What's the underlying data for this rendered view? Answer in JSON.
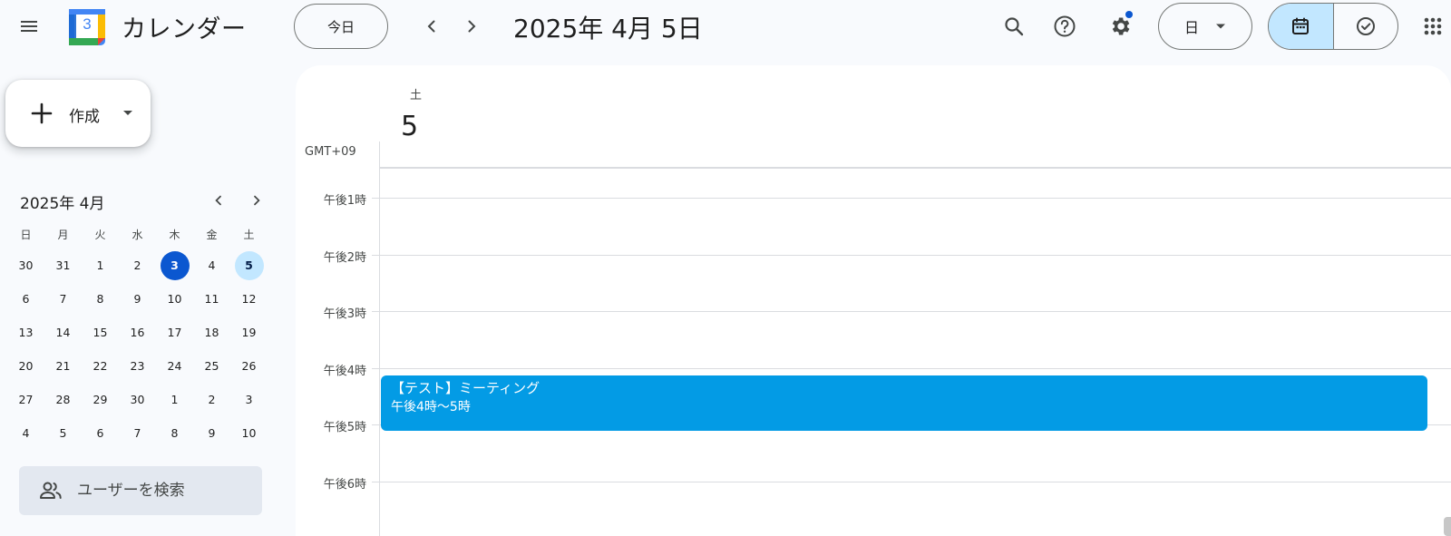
{
  "header": {
    "app_title": "カレンダー",
    "logo_number": "3",
    "today_label": "今日",
    "date_title": "2025年 4月 5日",
    "view_label": "日",
    "icons": [
      "menu-icon",
      "calendar-logo-icon",
      "chevron-left-icon",
      "chevron-right-icon",
      "search-icon",
      "help-icon",
      "settings-icon",
      "caret-down-icon",
      "calendar-icon",
      "task-check-icon",
      "apps-grid-icon"
    ]
  },
  "sidebar": {
    "create_label": "作成",
    "mini_calendar": {
      "month_label": "2025年 4月",
      "weekdays": [
        "日",
        "月",
        "火",
        "水",
        "木",
        "金",
        "土"
      ],
      "weeks": [
        [
          "30",
          "31",
          "1",
          "2",
          "3",
          "4",
          "5"
        ],
        [
          "6",
          "7",
          "8",
          "9",
          "10",
          "11",
          "12"
        ],
        [
          "13",
          "14",
          "15",
          "16",
          "17",
          "18",
          "19"
        ],
        [
          "20",
          "21",
          "22",
          "23",
          "24",
          "25",
          "26"
        ],
        [
          "27",
          "28",
          "29",
          "30",
          "1",
          "2",
          "3"
        ],
        [
          "4",
          "5",
          "6",
          "7",
          "8",
          "9",
          "10"
        ]
      ],
      "today": "3",
      "selected": "5"
    },
    "user_search_placeholder": "ユーザーを検索"
  },
  "main": {
    "day_of_week": "土",
    "day_number": "5",
    "timezone": "GMT+09",
    "hours": [
      "午後1時",
      "午後2時",
      "午後3時",
      "午後4時",
      "午後5時",
      "午後6時"
    ],
    "event": {
      "title": "【テスト】ミーティング",
      "time": "午後4時～5時",
      "color": "#039be5"
    }
  },
  "colors": {
    "accent": "#0b57d0",
    "selected_bg": "#c2e7ff",
    "background": "#f8fafd"
  }
}
